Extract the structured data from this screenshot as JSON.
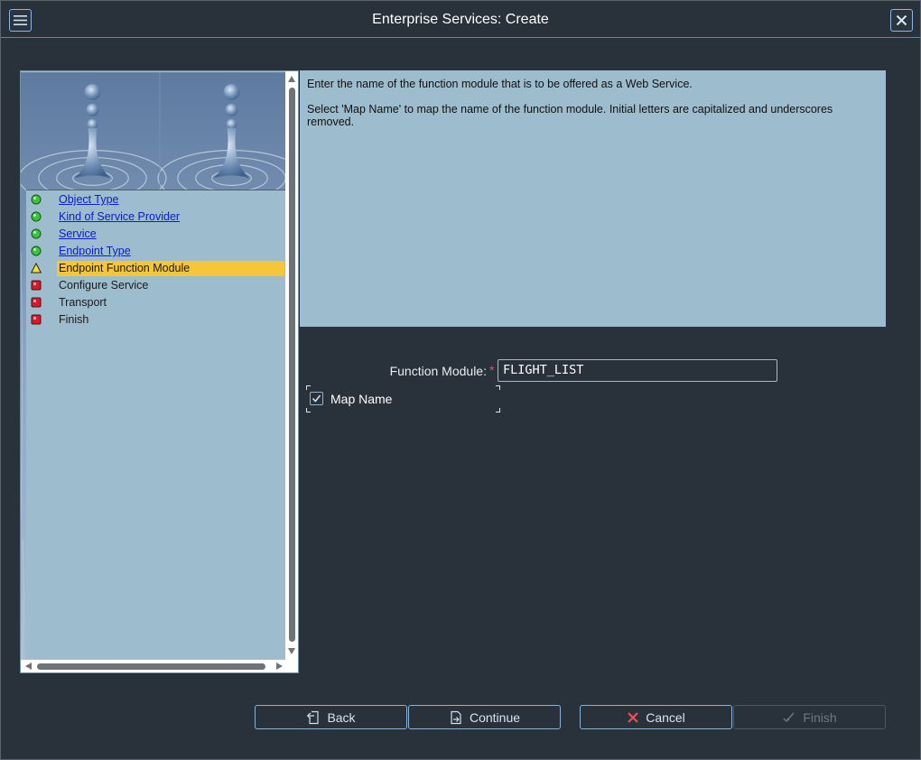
{
  "window": {
    "title": "Enterprise Services: Create"
  },
  "titlebar": {
    "menu_icon": "hamburger-icon",
    "close_icon": "close-icon"
  },
  "roadmap": {
    "steps": [
      {
        "label": "Object Type",
        "status": "completed",
        "icon": "green-dot-icon",
        "link": true
      },
      {
        "label": "Kind of Service Provider",
        "status": "completed",
        "icon": "green-dot-icon",
        "link": true
      },
      {
        "label": "Service",
        "status": "completed",
        "icon": "green-dot-icon",
        "link": true
      },
      {
        "label": "Endpoint Type",
        "status": "completed",
        "icon": "green-dot-icon",
        "link": true
      },
      {
        "label": "Endpoint Function Module",
        "status": "current",
        "icon": "warning-triangle-icon",
        "link": false
      },
      {
        "label": "Configure Service",
        "status": "pending",
        "icon": "red-square-icon",
        "link": false
      },
      {
        "label": "Transport",
        "status": "pending",
        "icon": "red-square-icon",
        "link": false
      },
      {
        "label": "Finish",
        "status": "pending",
        "icon": "red-square-icon",
        "link": false
      }
    ]
  },
  "info": {
    "line1": "Enter the name of the function module that is to be offered as a Web Service.",
    "line2": "Select 'Map Name' to map the name of the function module. Initial letters are capitalized and underscores removed."
  },
  "form": {
    "function_module_label": "Function Module:",
    "required_marker": "*",
    "function_module_value": "FLIGHT_LIST",
    "map_name_label": "Map Name",
    "map_name_checked": true
  },
  "buttons": {
    "back": "Back",
    "continue": "Continue",
    "cancel": "Cancel",
    "finish": "Finish"
  },
  "colors": {
    "background": "#29313a",
    "panel": "#9dbccd",
    "current_step": "#f5c53a",
    "link": "#0b20c8",
    "button_border": "#8ab3da",
    "required": "#e0566b"
  }
}
